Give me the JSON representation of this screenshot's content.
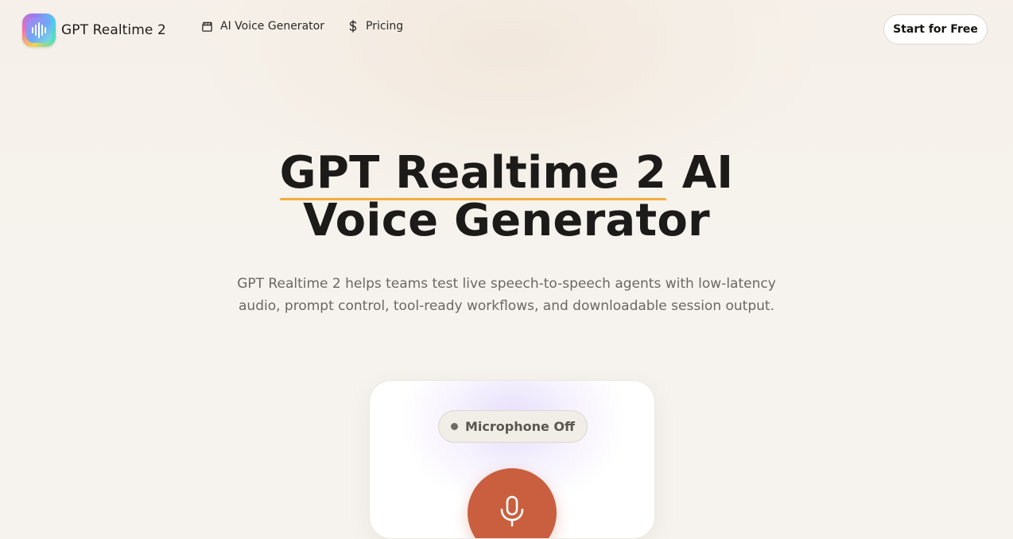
{
  "brand": {
    "name": "GPT Realtime 2",
    "logo_icon": "sound-wave-logo-icon"
  },
  "nav": {
    "items": [
      {
        "label": "AI Voice Generator",
        "icon": "clapperboard-icon"
      },
      {
        "label": "Pricing",
        "icon": "dollar-icon"
      }
    ],
    "cta_label": "Start for Free"
  },
  "hero": {
    "title_highlight": "GPT Realtime 2",
    "title_rest_line1": " AI",
    "title_line2": "Voice Generator",
    "subtitle_line1": "GPT Realtime 2 helps teams test live speech-to-speech agents with low-latency",
    "subtitle_line2": "audio, prompt control, tool-ready workflows, and downloadable session output."
  },
  "voice_card": {
    "status_label": "Microphone Off",
    "mic_icon": "microphone-icon"
  },
  "colors": {
    "accent_underline": "#f3ad3d",
    "mic_button": "#c95f3e",
    "background": "#f6f3ee"
  }
}
